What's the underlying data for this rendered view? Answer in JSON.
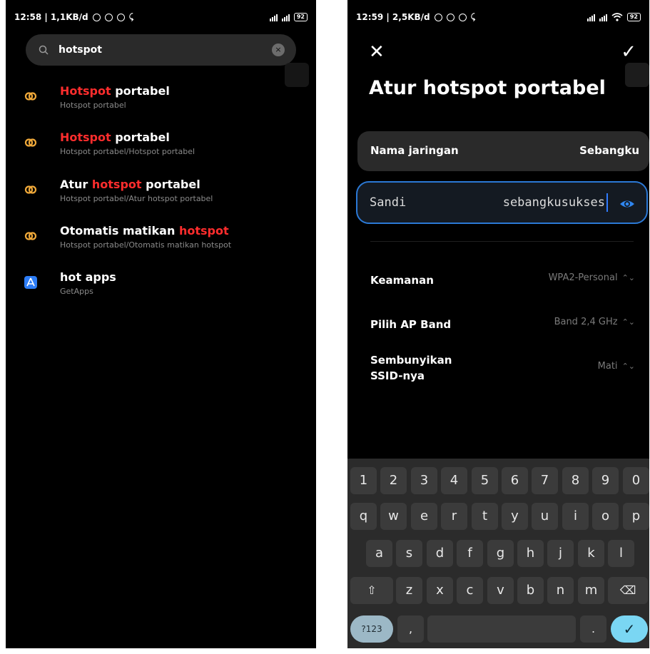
{
  "left": {
    "status": {
      "time": "12:58 | 1,1KB/d",
      "battery": "92"
    },
    "search": {
      "value": "hotspot",
      "clear": "×"
    },
    "results": [
      {
        "pre": "",
        "hl": "Hotspot",
        "post": " portabel",
        "sub": "Hotspot portabel"
      },
      {
        "pre": "",
        "hl": "Hotspot",
        "post": " portabel",
        "sub": "Hotspot portabel/Hotspot portabel"
      },
      {
        "pre": "Atur ",
        "hl": "hotspot",
        "post": " portabel",
        "sub": "Hotspot portabel/Atur hotspot portabel"
      },
      {
        "pre": "Otomatis matikan ",
        "hl": "hotspot",
        "post": "",
        "sub": "Hotspot portabel/Otomatis matikan hotspot"
      }
    ],
    "app": {
      "title": "hot apps",
      "sub": "GetApps"
    }
  },
  "right": {
    "status": {
      "time": "12:59 | 2,5KB/d",
      "battery": "92"
    },
    "close": "✕",
    "confirm": "✓",
    "title": "Atur hotspot portabel",
    "network": {
      "label": "Nama jaringan",
      "value": "Sebangku"
    },
    "password": {
      "label": "Sandi",
      "value": "sebangkusukses"
    },
    "security": {
      "label": "Keamanan",
      "value": "WPA2-Personal"
    },
    "band": {
      "label": "Pilih AP Band",
      "value": "Band 2,4 GHz"
    },
    "hide": {
      "label1": "Sembunyikan",
      "label2": "SSID-nya",
      "value": "Mati"
    },
    "keyboard": {
      "row1": [
        "1",
        "2",
        "3",
        "4",
        "5",
        "6",
        "7",
        "8",
        "9",
        "0"
      ],
      "row2": [
        "q",
        "w",
        "e",
        "r",
        "t",
        "y",
        "u",
        "i",
        "o",
        "p"
      ],
      "row3": [
        "a",
        "s",
        "d",
        "f",
        "g",
        "h",
        "j",
        "k",
        "l"
      ],
      "row4": [
        "z",
        "x",
        "c",
        "v",
        "b",
        "n",
        "m"
      ],
      "shift": "⇧",
      "backspace": "⌫",
      "sym": "?123",
      "comma": ",",
      "period": ".",
      "enter": "✓"
    }
  }
}
